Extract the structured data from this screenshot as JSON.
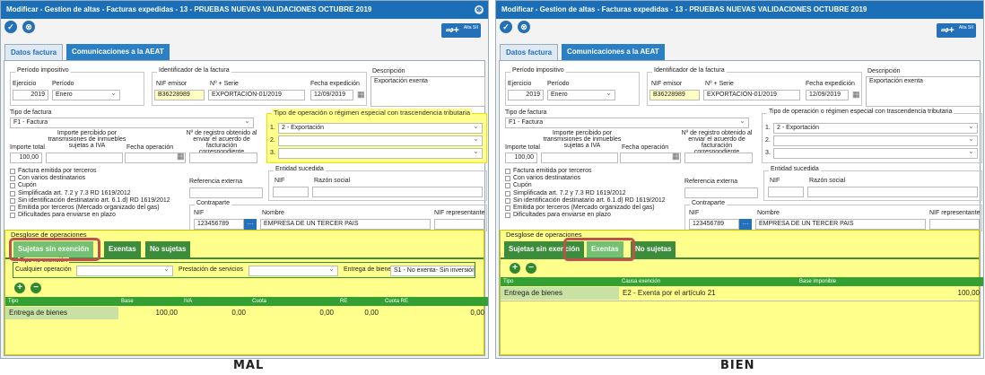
{
  "left": {
    "title": "Modificar - Gestion de altas - Facturas expedidas - 13 - PRUEBAS NUEVAS VALIDACIONES OCTUBRE 2019",
    "caption": "MAL",
    "active_breakdown_tab": "sujetas",
    "no_exenta": {
      "legend": "Tipo no exención",
      "op_label": "Cualquier operación",
      "prest_label": "Prestación de servicios",
      "entrega_label": "Entrega de bienes",
      "entrega_value": "S1 - No exenta- Sin inversión"
    },
    "cols": [
      "Tipo",
      "Base",
      "IVA",
      "Cuota",
      "RE",
      "Cuota RE"
    ],
    "row": [
      "Entrega de bienes",
      "100,00",
      "0,00",
      "0,00",
      "0,00",
      "0,00"
    ]
  },
  "right": {
    "title": "Modificar - Gestion de altas - Facturas expedidas - 13 - PRUEBAS NUEVAS VALIDACIONES OCTUBRE 2019",
    "caption": "BIEN",
    "active_breakdown_tab": "exentas",
    "cols": [
      "Tipo",
      "Causa exención",
      "Base imponible"
    ],
    "row": [
      "Entrega de bienes",
      "E2 - Exenta por el artículo 21",
      "100,00"
    ]
  },
  "common": {
    "close_icon": "⊗",
    "tab_datos": "Datos factura",
    "tab_aeat": "Comunicaciones a la AEAT",
    "alta_sii": "Alta SII",
    "periodo_legend": "Período impositivo",
    "ejercicio_label": "Ejercicio",
    "ejercicio": "2019",
    "periodo_label": "Período",
    "periodo": "Enero",
    "identificador_legend": "Identificador de la factura",
    "nif_emisor_label": "NIF emisor",
    "nif_emisor": "B36228989",
    "serie_label": "Nº + Serie",
    "serie": "EXPORTACION-01/2019",
    "fecha_exp_label": "Fecha expedición",
    "fecha_exp": "12/09/2019",
    "descripcion_label": "Descripción",
    "descripcion": "Exportación exenta",
    "tipo_factura_label": "Tipo de factura",
    "tipo_factura": "F1 - Factura",
    "importe_total_label": "Importe total",
    "importe_total": "100,00",
    "importe_percibido_label": "Importe percibido por transmisiones de inmuebles sujetas a IVA",
    "fecha_operacion_label": "Fecha operación",
    "n_registro_label": "Nº de registro obtenido al enviar el acuerdo de facturación correspondiente",
    "regimen_legend": "Tipo de operación o régimen especial con trascendencia tributaria",
    "regimen_1": "2 - Exportación",
    "num_1": "1.",
    "num_2": "2.",
    "num_3": "3.",
    "checkboxes": [
      "Factura emitida por terceros",
      "Con varios destinatarios",
      "Cupón",
      "Simplificada art. 7.2 y 7.3 RD 1619/2012",
      "Sin identificación destinatario art. 6.1.d) RD 1619/2012",
      "Emitida por terceros (Mercado organizado del gas)",
      "Dificultades para enviarse en plazo"
    ],
    "ref_externa_label": "Referencia externa",
    "entidad_legend": "Entidad sucedida",
    "nif_label": "NIF",
    "razon_social_label": "Razón social",
    "contraparte_legend": "Contraparte",
    "cp_nif": "123456789",
    "nombre_label": "Nombre",
    "cp_nombre": "EMPRESA DE UN TERCER PAIS",
    "nif_rep_label": "NIF representante",
    "desglose_legend": "Desglose de operaciones",
    "tab_sujetas": "Sujetas sin exención",
    "tab_exentas": "Exentas",
    "tab_no_sujetas": "No sujetas",
    "add_icon": "+",
    "remove_icon": "−",
    "calendar_icon": "▦",
    "lookup_icon": "…"
  }
}
